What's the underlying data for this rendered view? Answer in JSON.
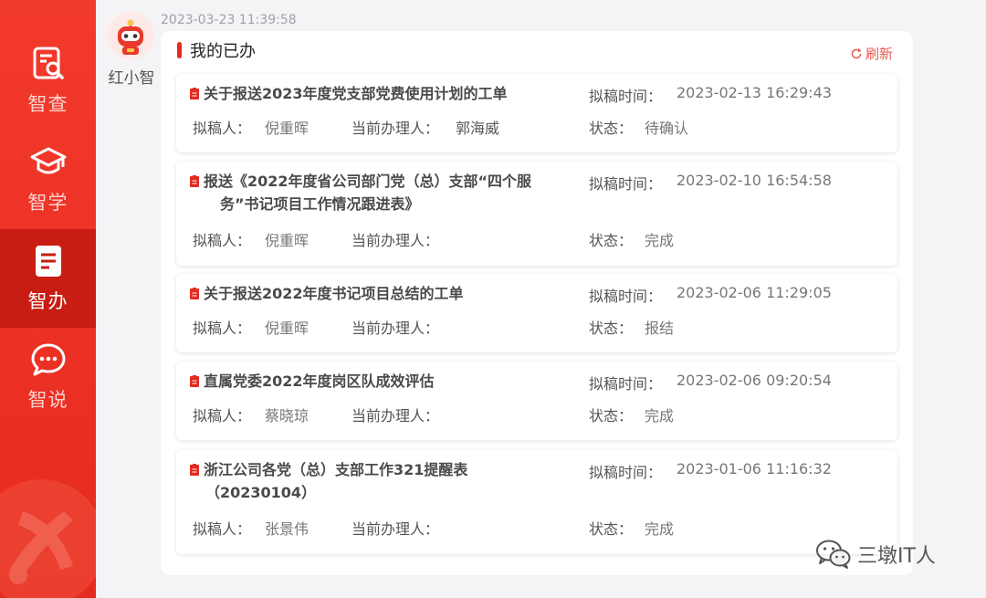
{
  "sidebar": {
    "items": [
      {
        "label": "智查",
        "icon": "search-document-icon"
      },
      {
        "label": "智学",
        "icon": "graduation-cap-icon"
      },
      {
        "label": "智办",
        "icon": "document-list-icon",
        "active": true
      },
      {
        "label": "智说",
        "icon": "chat-bubble-icon"
      }
    ]
  },
  "chat": {
    "bot_name": "红小智",
    "timestamp": "2023-03-23 11:39:58"
  },
  "panel": {
    "title": "我的已办",
    "refresh_label": "刷新",
    "labels": {
      "draft_time": "拟稿时间：",
      "drafter": "拟稿人：",
      "handler": "当前办理人：",
      "status": "状态："
    },
    "items": [
      {
        "title_lines": [
          "关于报送2023年度党支部党费使用计划的工单"
        ],
        "draft_time": "2023-02-13 16:29:43",
        "drafter": "倪重晖",
        "handler": "郭海威",
        "status": "待确认"
      },
      {
        "title_lines": [
          "报送《2022年度省公司部门党（总）支部“四个服",
          "务”书记项目工作情况跟进表》"
        ],
        "draft_time": "2023-02-10 16:54:58",
        "drafter": "倪重晖",
        "handler": "",
        "status": "完成"
      },
      {
        "title_lines": [
          "关于报送2022年度书记项目总结的工单"
        ],
        "draft_time": "2023-02-06 11:29:05",
        "drafter": "倪重晖",
        "handler": "",
        "status": "报结"
      },
      {
        "title_lines": [
          "直属党委2022年度岗区队成效评估"
        ],
        "draft_time": "2023-02-06 09:20:54",
        "drafter": "蔡晓琼",
        "handler": "",
        "status": "完成"
      },
      {
        "title_lines": [
          "浙江公司各党（总）支部工作321提醒表",
          "（20230104）"
        ],
        "draft_time": "2023-01-06 11:16:32",
        "drafter": "张景伟",
        "handler": "",
        "status": "完成"
      }
    ]
  },
  "watermark": {
    "text": "三墩IT人",
    "icon": "wechat-icon"
  },
  "colors": {
    "brand_red": "#e52a1e",
    "active_red": "#c81d12",
    "refresh": "#e85a4f"
  }
}
